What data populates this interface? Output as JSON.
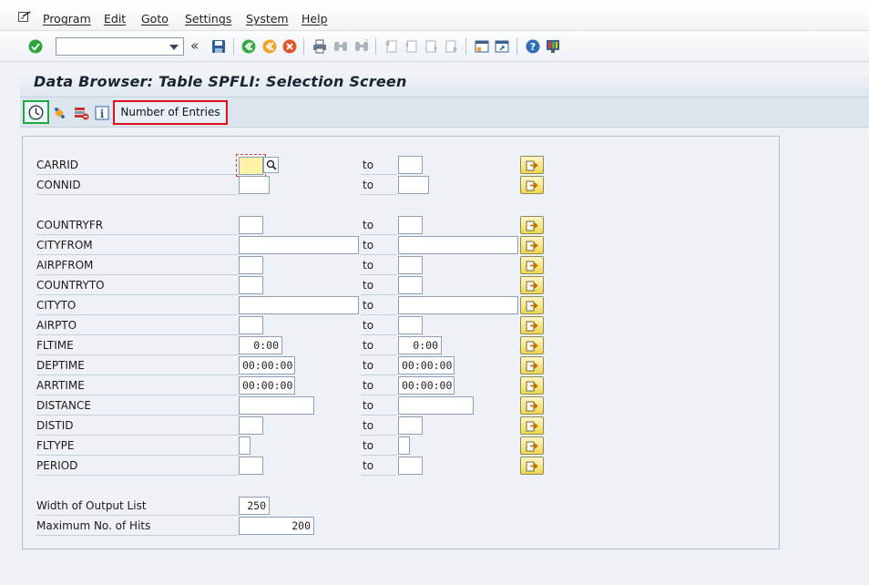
{
  "menu": {
    "items": [
      "Program",
      "Edit",
      "Goto",
      "Settings",
      "System",
      "Help"
    ]
  },
  "toolbar": {
    "command_field": {
      "value": "",
      "placeholder": ""
    },
    "icons": [
      "enter-icon",
      "back-arrows-icon",
      "save-icon",
      "back-icon",
      "exit-icon",
      "cancel-icon",
      "print-icon",
      "find-icon",
      "find-next-icon",
      "first-page-icon",
      "previous-page-icon",
      "next-page-icon",
      "last-page-icon",
      "create-session-icon",
      "shortcut-icon",
      "help-icon",
      "layout-icon"
    ]
  },
  "title": "Data Browser: Table SPFLI: Selection Screen",
  "app_toolbar": {
    "execute_icon": "execute-icon",
    "number_of_entries_label": "Number of Entries"
  },
  "selection": {
    "to_label": "to",
    "fields": [
      {
        "label": "CARRID",
        "low": "",
        "high": ""
      },
      {
        "label": "CONNID",
        "low": "",
        "high": ""
      },
      {
        "label": "COUNTRYFR",
        "low": "",
        "high": ""
      },
      {
        "label": "CITYFROM",
        "low": "",
        "high": ""
      },
      {
        "label": "AIRPFROM",
        "low": "",
        "high": ""
      },
      {
        "label": "COUNTRYTO",
        "low": "",
        "high": ""
      },
      {
        "label": "CITYTO",
        "low": "",
        "high": ""
      },
      {
        "label": "AIRPTO",
        "low": "",
        "high": ""
      },
      {
        "label": "FLTIME",
        "low": "0:00",
        "high": "0:00"
      },
      {
        "label": "DEPTIME",
        "low": "00:00:00",
        "high": "00:00:00"
      },
      {
        "label": "ARRTIME",
        "low": "00:00:00",
        "high": "00:00:00"
      },
      {
        "label": "DISTANCE",
        "low": "",
        "high": ""
      },
      {
        "label": "DISTID",
        "low": "",
        "high": ""
      },
      {
        "label": "FLTYPE",
        "low": "",
        "high": ""
      },
      {
        "label": "PERIOD",
        "low": "",
        "high": ""
      }
    ],
    "width_of_output_list": {
      "label": "Width of Output List",
      "value": "250"
    },
    "maximum_no_of_hits": {
      "label": "Maximum No. of Hits",
      "value": "200"
    }
  },
  "colors": {
    "execute_highlight": "#1faa3c",
    "entries_highlight": "#e0101a",
    "focused_field": "#fff3a8"
  }
}
